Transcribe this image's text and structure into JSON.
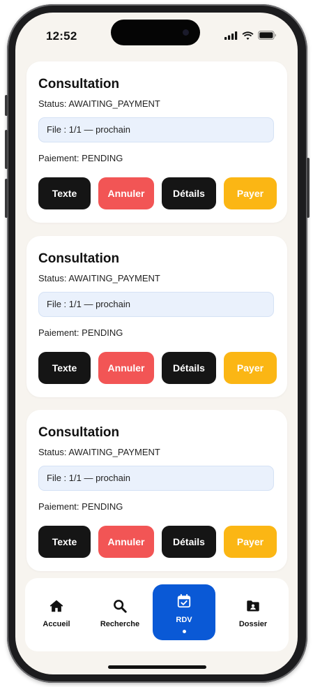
{
  "status_bar": {
    "time": "12:52",
    "icons": [
      "signal-icon",
      "wifi-icon",
      "battery-icon"
    ]
  },
  "cards": [
    {
      "title": "Consultation",
      "status": "Status: AWAITING_PAYMENT",
      "file": "File : 1/1 — prochain",
      "payment": "Paiement: PENDING",
      "buttons": {
        "texte": "Texte",
        "annuler": "Annuler",
        "details": "Détails",
        "payer": "Payer"
      }
    },
    {
      "title": "Consultation",
      "status": "Status: AWAITING_PAYMENT",
      "file": "File : 1/1 — prochain",
      "payment": "Paiement: PENDING",
      "buttons": {
        "texte": "Texte",
        "annuler": "Annuler",
        "details": "Détails",
        "payer": "Payer"
      }
    },
    {
      "title": "Consultation",
      "status": "Status: AWAITING_PAYMENT",
      "file": "File : 1/1 — prochain",
      "payment": "Paiement: PENDING",
      "buttons": {
        "texte": "Texte",
        "annuler": "Annuler",
        "details": "Détails",
        "payer": "Payer"
      }
    }
  ],
  "tabbar": {
    "tabs": [
      {
        "label": "Accueil",
        "icon": "home-icon",
        "active": false
      },
      {
        "label": "Recherche",
        "icon": "search-icon",
        "active": false
      },
      {
        "label": "RDV",
        "icon": "calendar-check-icon",
        "active": true
      },
      {
        "label": "Dossier",
        "icon": "folder-user-icon",
        "active": false
      }
    ]
  },
  "colors": {
    "background": "#f7f4ef",
    "card": "#ffffff",
    "button_dark": "#151515",
    "button_cancel": "#f25555",
    "button_pay": "#fbb614",
    "tab_active": "#0a59d6",
    "file_box": "#eaf1fc"
  }
}
